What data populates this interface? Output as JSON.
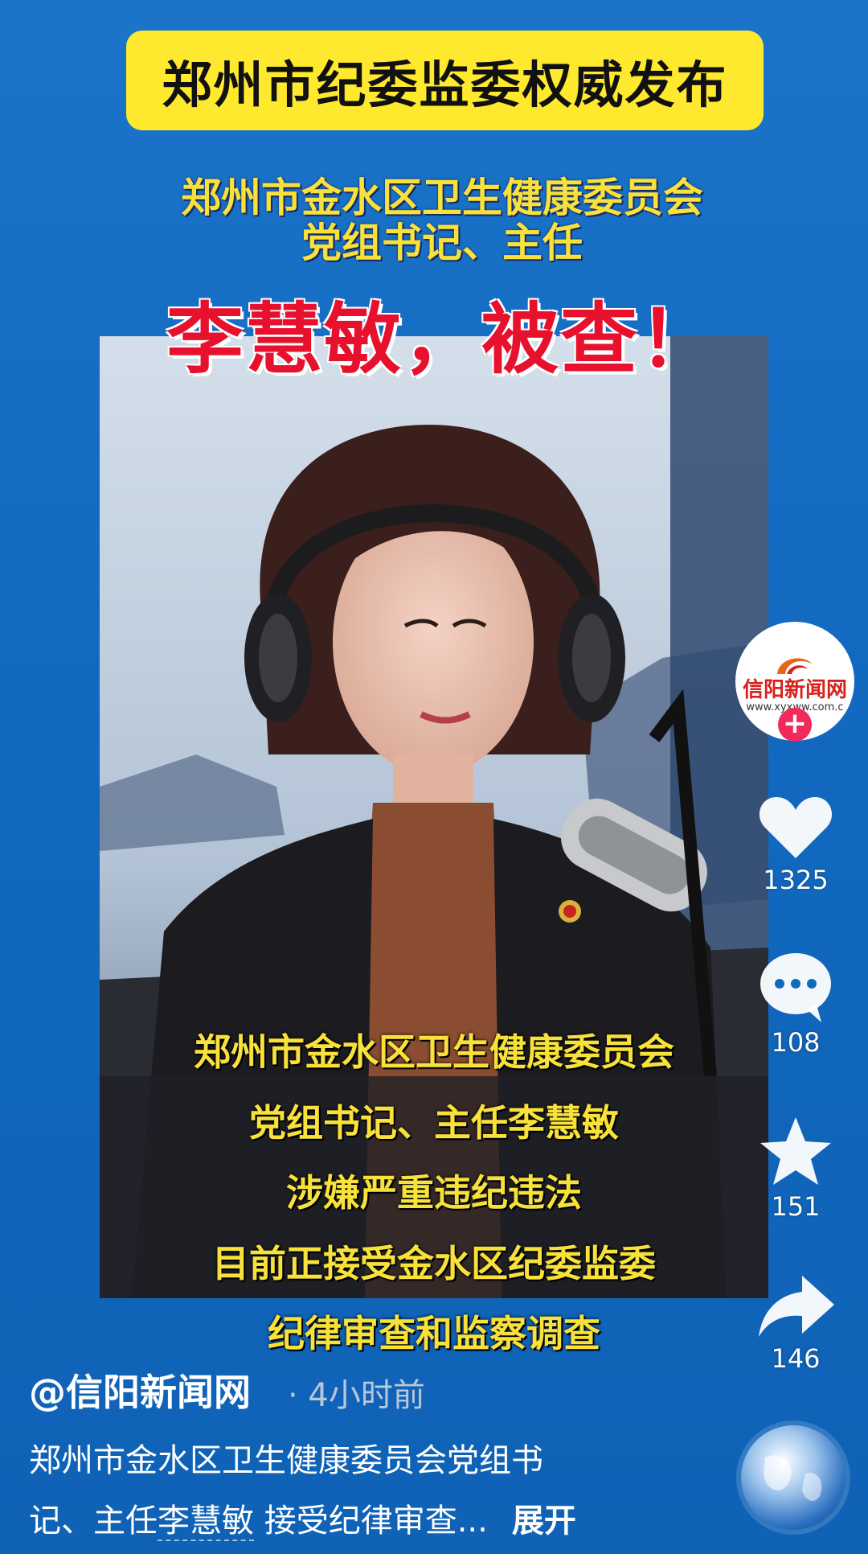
{
  "banner": {
    "title": "郑州市纪委监委权威发布"
  },
  "subtitle": {
    "line1": "郑州市金水区卫生健康委员会",
    "line2": "党组书记、主任"
  },
  "headline": "李慧敏，被查！",
  "overlay_text": [
    "郑州市金水区卫生健康委员会",
    "党组书记、主任李慧敏",
    "涉嫌严重违纪违法",
    "目前正接受金水区纪委监委",
    "纪律审查和监察调查"
  ],
  "side": {
    "avatar_logo": "信阳新闻网",
    "avatar_url": "www.xyxww.com.c",
    "follow_icon": "plus-icon",
    "likes": "1325",
    "comments": "108",
    "favorites": "151",
    "shares": "146"
  },
  "post": {
    "author": "@信阳新闻网",
    "time": "· 4小时前",
    "desc_line1": "郑州市金水区卫生健康委员会党组书",
    "desc_line2_prefix": "记、主任",
    "desc_name": "李慧敏",
    "desc_line2_suffix": "接受纪律审查...",
    "expand": "展开"
  },
  "colors": {
    "background": "#1169bf",
    "banner": "#ffe92e",
    "headline": "#e8112d",
    "overlay": "#f7e13a",
    "follow": "#f2295b"
  }
}
